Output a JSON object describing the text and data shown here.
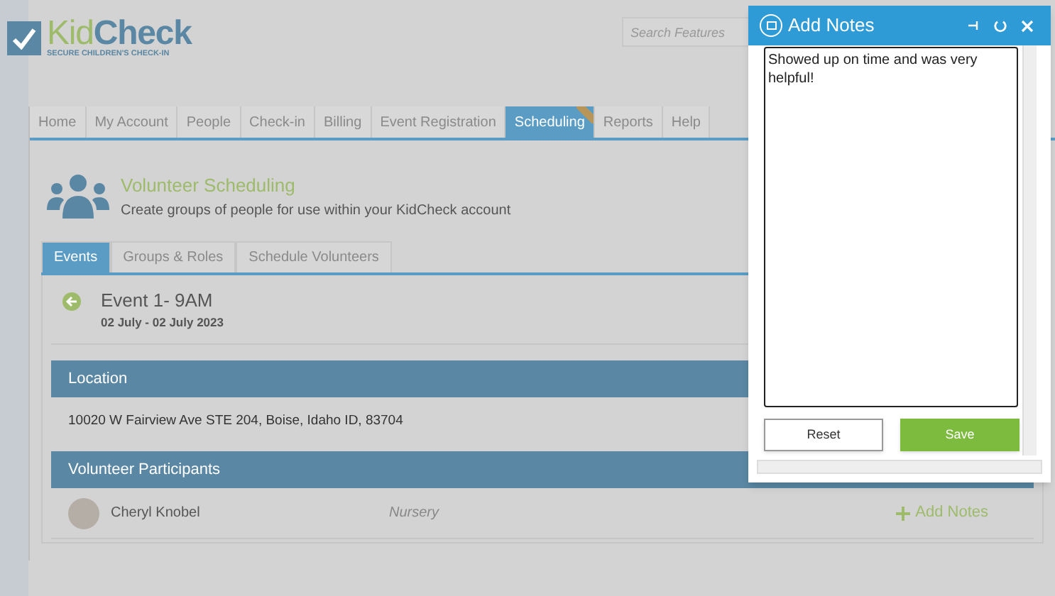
{
  "logo": {
    "part_1": "Kid",
    "part_2": "Check",
    "tagline": "SECURE CHILDREN'S CHECK-IN"
  },
  "search": {
    "placeholder": "Search Features"
  },
  "nav_tabs": [
    {
      "label": "Home",
      "selected": false,
      "ribbon": false
    },
    {
      "label": "My Account",
      "selected": false,
      "ribbon": false
    },
    {
      "label": "People",
      "selected": false,
      "ribbon": false
    },
    {
      "label": "Check-in",
      "selected": false,
      "ribbon": false
    },
    {
      "label": "Billing",
      "selected": false,
      "ribbon": false
    },
    {
      "label": "Event Registration",
      "selected": false,
      "ribbon": false
    },
    {
      "label": "Scheduling",
      "selected": true,
      "ribbon": true
    },
    {
      "label": "Reports",
      "selected": false,
      "ribbon": false
    },
    {
      "label": "Help",
      "selected": false,
      "ribbon": false
    }
  ],
  "page": {
    "title": "Volunteer Scheduling",
    "subtitle": "Create groups of people for use within your KidCheck account"
  },
  "sub_tabs": [
    {
      "label": "Events",
      "selected": true
    },
    {
      "label": "Groups & Roles",
      "selected": false
    },
    {
      "label": "Schedule Volunteers",
      "selected": false
    }
  ],
  "event": {
    "title": "Event 1- 9AM",
    "dates": "02 July - 02 July 2023"
  },
  "location": {
    "heading": "Location",
    "address": "10020 W Fairview Ave STE 204, Boise, Idaho ID, 83704"
  },
  "participants": {
    "heading": "Volunteer Participants",
    "rows": [
      {
        "name": "Cheryl Knobel",
        "role": "Nursery",
        "action": "Add Notes"
      }
    ]
  },
  "dialog": {
    "title": "Add Notes",
    "note": "Showed up on time and was very helpful!",
    "buttons": [
      {
        "label": "Reset",
        "kind": "secondary"
      },
      {
        "label": "Save",
        "kind": "primary"
      }
    ]
  }
}
